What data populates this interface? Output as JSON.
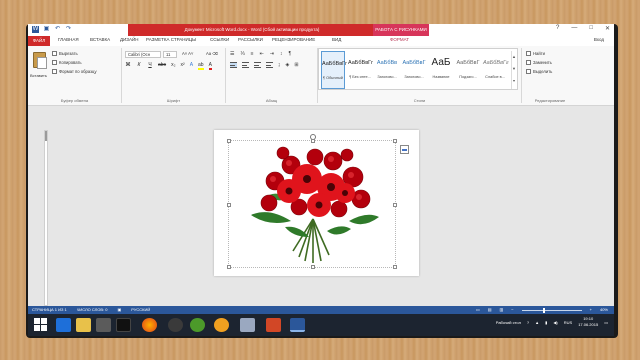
{
  "window": {
    "title": "Документ Microsoft Word.docx - Word (Сбой активации продукта)",
    "context_tab": "РАБОТА С РИСУНКАМИ",
    "minimize": "—",
    "maximize": "□",
    "close": "✕",
    "help": "?"
  },
  "tabs": {
    "file": "ФАЙЛ",
    "home": "ГЛАВНАЯ",
    "insert": "ВСТАВКА",
    "design": "ДИЗАЙН",
    "layout": "РАЗМЕТКА СТРАНИЦЫ",
    "references": "ССЫЛКИ",
    "mailings": "РАССЫЛКИ",
    "review": "РЕЦЕНЗИРОВАНИЕ",
    "view": "ВИД",
    "format": "ФОРМАТ",
    "user": "Вход"
  },
  "ribbon": {
    "clipboard": {
      "paste": "Вставить",
      "cut": "Вырезать",
      "copy": "Копировать",
      "format_painter": "Формат по образцу",
      "label": "Буфер обмена"
    },
    "font": {
      "name": "Calibri (Осн",
      "size": "11",
      "label": "Шрифт"
    },
    "paragraph": {
      "label": "Абзац"
    },
    "styles": {
      "label": "Стили",
      "items": [
        {
          "sample": "АаБбВвГг",
          "name": "¶ Обычный"
        },
        {
          "sample": "АаБбВвГг",
          "name": "¶ Без инте..."
        },
        {
          "sample": "АаБбВв",
          "name": "Заголово..."
        },
        {
          "sample": "АаБбВвГ",
          "name": "Заголово..."
        },
        {
          "sample": "АаБ",
          "name": "Название"
        },
        {
          "sample": "АаБбВвГ",
          "name": "Подзаго..."
        },
        {
          "sample": "АаБбВвГг",
          "name": "Слабое в..."
        }
      ]
    },
    "editing": {
      "find": "Найти",
      "replace": "Заменить",
      "select": "Выделить",
      "label": "Редактирование"
    }
  },
  "status": {
    "page": "СТРАНИЦА 1 ИЗ 1",
    "words": "ЧИСЛО СЛОВ: 0",
    "lang": "РУССКИЙ",
    "zoom": "40%",
    "zoom_fraction": 0.35
  },
  "taskbar": {
    "desktop_label": "Рабочий стол",
    "lang": "RUS",
    "time": "19:10",
    "date": "17.06.2015"
  },
  "colors": {
    "word_blue": "#2b579a",
    "title_red": "#cf2a2a",
    "context_pink": "#d7355a"
  }
}
